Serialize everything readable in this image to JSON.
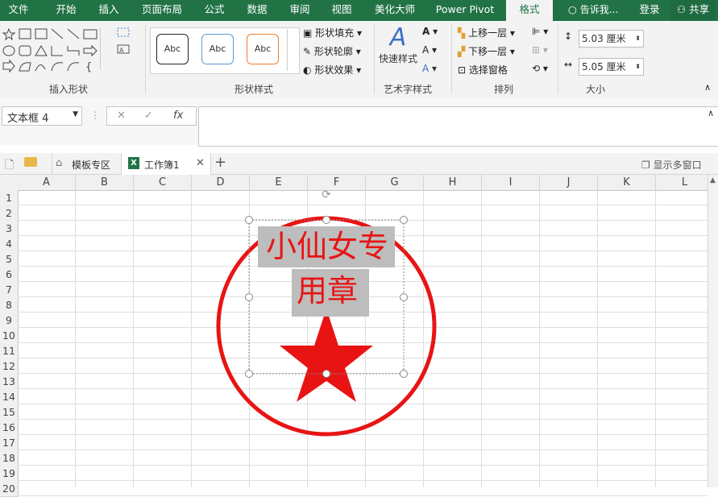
{
  "tabs": [
    "文件",
    "开始",
    "插入",
    "页面布局",
    "公式",
    "数据",
    "审阅",
    "视图",
    "美化大师",
    "Power Pivot",
    "格式"
  ],
  "tell_me": "告诉我...",
  "login": "登录",
  "share": "共享",
  "ribbon": {
    "insert_shapes_label": "插入形状",
    "shape_styles_label": "形状样式",
    "wordart_label": "艺术字样式",
    "arrange_label": "排列",
    "size_label": "大小",
    "style_sample": "Abc",
    "fill": "形状填充",
    "outline": "形状轮廓",
    "effect": "形状效果",
    "quick_styles": "快速样式",
    "bring_forward": "上移一层",
    "send_backward": "下移一层",
    "selection_pane": "选择窗格",
    "height_value": "5.03 厘米",
    "width_value": "5.05 厘米"
  },
  "formula_bar": {
    "name_box": "文本框 4",
    "fx": "fx",
    "cancel": "✕",
    "confirm": "✓"
  },
  "workbook_tabs": {
    "template": "模板专区",
    "workbook": "工作簿1",
    "close": "✕",
    "add": "+",
    "multi_window": "显示多窗口"
  },
  "columns": [
    "A",
    "B",
    "C",
    "D",
    "E",
    "F",
    "G",
    "H",
    "I",
    "J",
    "K",
    "L"
  ],
  "rows": [
    "1",
    "2",
    "3",
    "4",
    "5",
    "6",
    "7",
    "8",
    "9",
    "10",
    "11",
    "12",
    "13",
    "14",
    "15",
    "16",
    "17",
    "18",
    "19",
    "20"
  ],
  "stamp": {
    "line1": "小仙女专",
    "line2": "用章",
    "color": "#e81414"
  },
  "colors": {
    "accent": "#217346",
    "stamp_red": "#e81414"
  }
}
